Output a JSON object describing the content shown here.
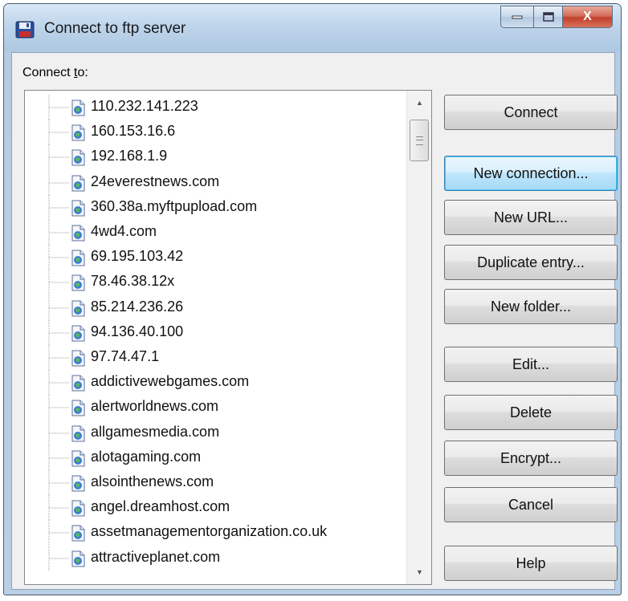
{
  "window": {
    "title": "Connect to ftp server",
    "controls": {
      "minimize_icon": "minimize-icon",
      "maximize_icon": "maximize-icon",
      "close_icon": "close-icon",
      "close_glyph": "X"
    }
  },
  "connect_to_label_prefix": "Connect ",
  "connect_to_label_mnemonic": "t",
  "connect_to_label_suffix": "o:",
  "tree_items": [
    "110.232.141.223",
    "160.153.16.6",
    "192.168.1.9",
    "24everestnews.com",
    "360.38a.myftpupload.com",
    "4wd4.com",
    "69.195.103.42",
    "78.46.38.12x",
    "85.214.236.26",
    "94.136.40.100",
    "97.74.47.1",
    "addictivewebgames.com",
    "alertworldnews.com",
    "allgamesmedia.com",
    "alotagaming.com",
    "alsointhenews.com",
    "angel.dreamhost.com",
    "assetmanagementorganization.co.uk",
    "attractiveplanet.com"
  ],
  "buttons": {
    "connect": "Connect",
    "new_connection": "New connection...",
    "new_url": "New URL...",
    "duplicate_entry": "Duplicate entry...",
    "new_folder": "New folder...",
    "edit": "Edit...",
    "delete": "Delete",
    "encrypt": "Encrypt...",
    "cancel": "Cancel",
    "help": "Help"
  },
  "colors": {
    "accent": "#48c4f6",
    "close": "#c1402c"
  }
}
